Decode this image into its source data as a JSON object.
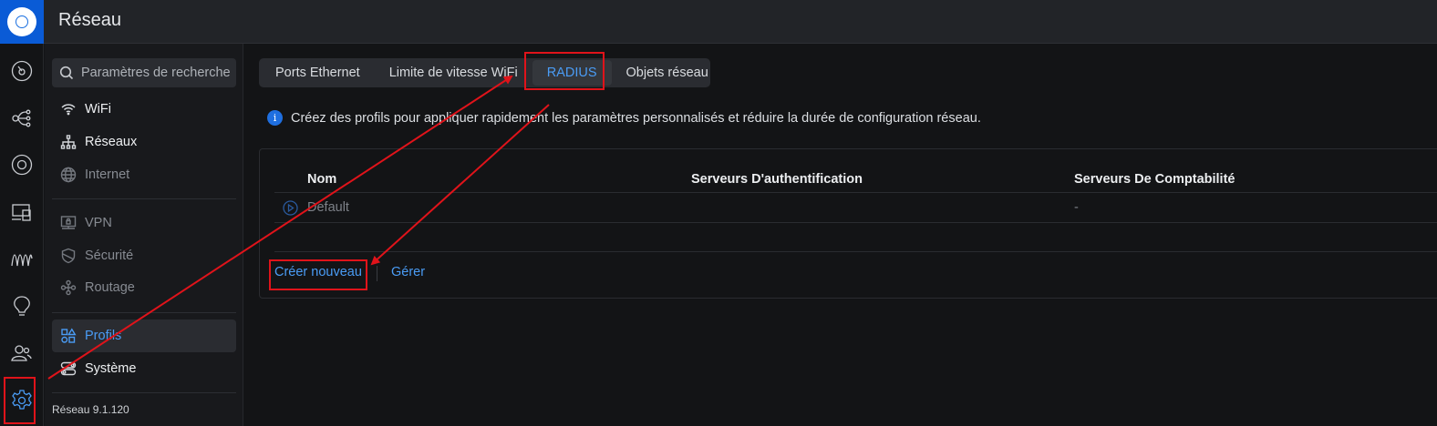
{
  "app": {
    "title": "Réseau"
  },
  "rail": [
    {
      "icon": "dashboard-icon"
    },
    {
      "icon": "topology-icon"
    },
    {
      "icon": "devices-icon"
    },
    {
      "icon": "clients-icon"
    },
    {
      "icon": "statistics-icon"
    },
    {
      "icon": "insights-icon"
    },
    {
      "icon": "users-icon"
    },
    {
      "icon": "settings-icon",
      "active": true
    }
  ],
  "sidebar": {
    "search_placeholder": "Paramètres de recherche",
    "items": [
      {
        "label": "WiFi",
        "icon": "wifi-icon"
      },
      {
        "label": "Réseaux",
        "icon": "networks-icon"
      },
      {
        "label": "Internet",
        "icon": "globe-icon"
      },
      {
        "label": "VPN",
        "icon": "vpn-icon"
      },
      {
        "label": "Sécurité",
        "icon": "shield-icon"
      },
      {
        "label": "Routage",
        "icon": "routing-icon"
      },
      {
        "label": "Profils",
        "icon": "profiles-icon",
        "active": true
      },
      {
        "label": "Système",
        "icon": "system-icon"
      }
    ],
    "version": "Réseau 9.1.120"
  },
  "tabs": [
    {
      "label": "Ports Ethernet"
    },
    {
      "label": "Limite de vitesse WiFi"
    },
    {
      "label": "RADIUS",
      "active": true
    },
    {
      "label": "Objets réseau"
    }
  ],
  "info": {
    "icon_glyph": "i",
    "text": "Créez des profils pour appliquer rapidement les paramètres personnalisés et réduire la durée de configuration réseau."
  },
  "table": {
    "columns": [
      "Nom",
      "Serveurs D'authentification",
      "Serveurs De Comptabilité"
    ],
    "rows": [
      {
        "name": "Default",
        "auth": "",
        "accounting": "-"
      }
    ]
  },
  "actions": {
    "create": "Créer nouveau",
    "manage": "Gérer"
  },
  "colors": {
    "accent": "#4a9cf5",
    "brand": "#0a5bd6",
    "highlight": "#e0131a",
    "background": "#131416"
  }
}
